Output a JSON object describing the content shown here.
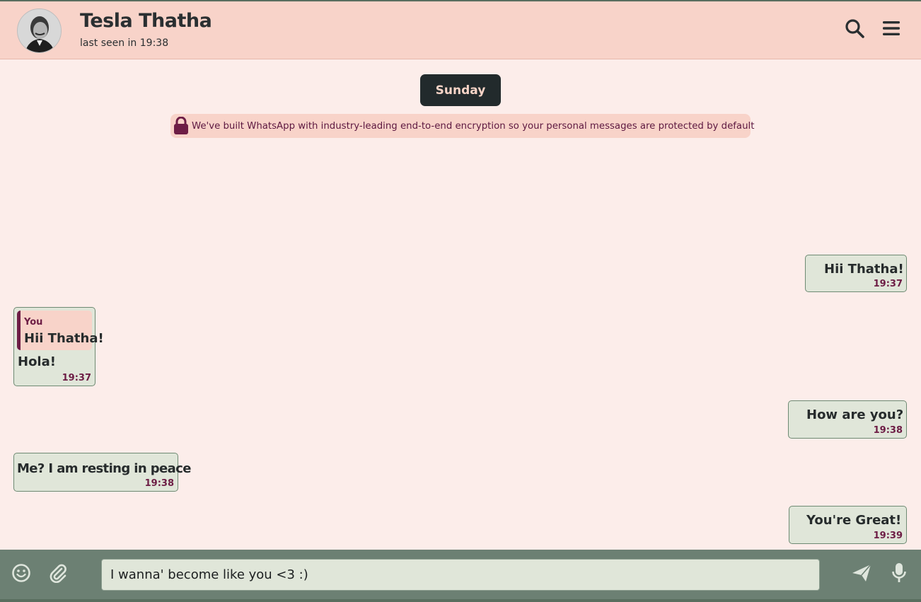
{
  "header": {
    "contact_name": "Tesla Thatha",
    "last_seen": "last seen in 19:38",
    "avatar_icon": "profile-photo",
    "search_icon": "search-icon",
    "menu_icon": "hamburger-menu-icon"
  },
  "chat": {
    "day_label": "Sunday",
    "encryption_notice": "We've built WhatsApp with industry-leading end-to-end encryption so your personal messages are protected by default",
    "messages": [
      {
        "side": "right",
        "text": "Hii Thatha!",
        "time": "19:37"
      },
      {
        "side": "left",
        "reply_to_author": "You",
        "reply_to_text": "Hii Thatha!",
        "text": "Hola!",
        "time": "19:37"
      },
      {
        "side": "right",
        "text": "How are you?",
        "time": "19:38"
      },
      {
        "side": "left",
        "text": "Me? I am resting in peace",
        "time": "19:38"
      },
      {
        "side": "right",
        "text": "You're Great!",
        "time": "19:39"
      }
    ]
  },
  "footer": {
    "input_value": "I wanna' become like you <3 :)",
    "emoji_icon": "emoji-icon",
    "attach_icon": "paperclip-icon",
    "send_icon": "send-icon",
    "mic_icon": "microphone-icon"
  },
  "colors": {
    "header_bg": "#f8d3c9",
    "chat_bg": "#fcedea",
    "bubble_bg": "#e0e6d9",
    "accent": "#6d1d45",
    "footer_bg": "#6c8073",
    "day_chip_bg": "#222a2c"
  }
}
